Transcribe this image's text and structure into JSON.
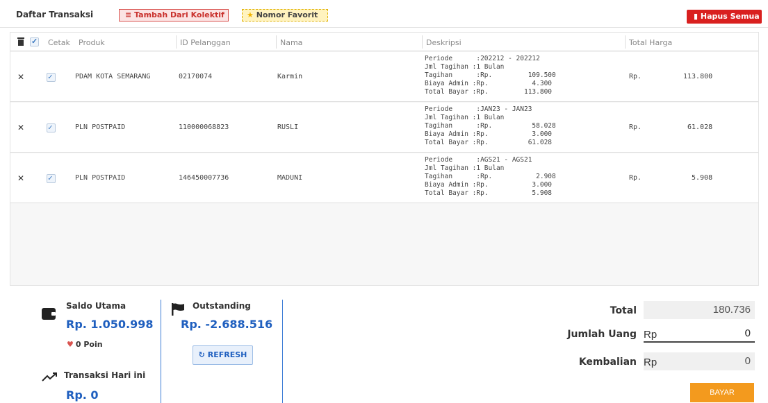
{
  "header": {
    "title": "Daftar Transaksi",
    "kolektif_label": "Tambah Dari Kolektif",
    "favorit_label": "Nomor Favorit",
    "hapus_label": "Hapus Semua"
  },
  "table": {
    "columns": [
      "Cetak",
      "Produk",
      "ID Pelanggan",
      "Nama",
      "Deskripsi",
      "Total Harga"
    ],
    "rows": [
      {
        "produk": "PDAM KOTA SEMARANG",
        "id": "02170074",
        "nama": "Karmin",
        "desc": "Periode      :202212 - 202212\nJml Tagihan :1 Bulan\nTagihan      :Rp.         109.500\nBiaya Admin :Rp.           4.300\nTotal Bayar :Rp.         113.800",
        "rp": "Rp.",
        "total": "113.800"
      },
      {
        "produk": "PLN POSTPAID",
        "id": "110000068823",
        "nama": "RUSLI",
        "desc": "Periode      :JAN23 - JAN23\nJml Tagihan :1 Bulan\nTagihan      :Rp.          58.028\nBiaya Admin :Rp.           3.000\nTotal Bayar :Rp.          61.028",
        "rp": "Rp.",
        "total": "61.028"
      },
      {
        "produk": "PLN POSTPAID",
        "id": "146450007736",
        "nama": "MADUNI",
        "desc": "Periode      :AGS21 - AGS21\nJml Tagihan :1 Bulan\nTagihan      :Rp.           2.908\nBiaya Admin :Rp.           3.000\nTotal Bayar :Rp.           5.908",
        "rp": "Rp.",
        "total": "5.908"
      }
    ]
  },
  "footer": {
    "saldo_label": "Saldo Utama",
    "saldo_value": "Rp. 1.050.998",
    "poin": "0 Poin",
    "trx_label": "Transaksi Hari ini",
    "trx_value": "Rp. 0",
    "outstanding_label": "Outstanding",
    "outstanding_value": "Rp. -2.688.516",
    "refresh_label": "REFRESH",
    "total_label": "Total",
    "jumlah_label": "Jumlah Uang",
    "kembalian_label": "Kembalian",
    "rp": "Rp",
    "total_value": "180.736",
    "jumlah_value": "0",
    "kembalian_value": "0",
    "bayar_label": "BAYAR"
  },
  "colors": {
    "accent_blue": "#1f5fbf",
    "danger_red": "#d9201f",
    "bayar_orange": "#f39a1e"
  }
}
